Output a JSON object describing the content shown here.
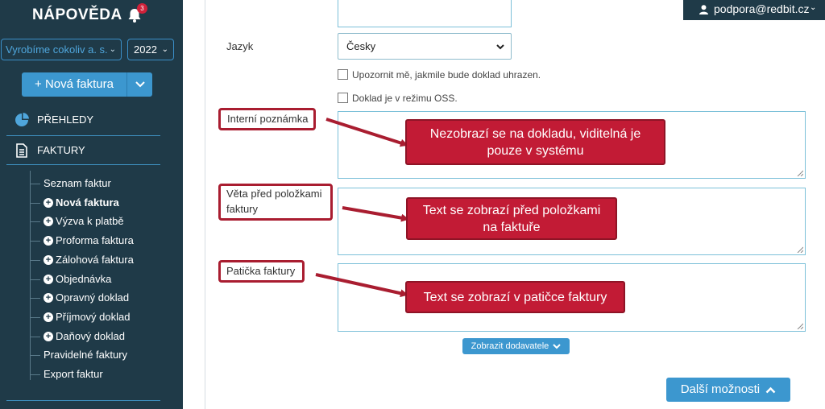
{
  "sidebar": {
    "brand": "NÁPOVĚDA",
    "notification_count": "3",
    "company_select": "Vyrobíme cokoliv a. s.",
    "year_select": "2022",
    "new_invoice_button": "+ Nová faktura",
    "sections": {
      "prehledy": "PŘEHLEDY",
      "faktury": "FAKTURY"
    },
    "items": [
      {
        "label": "Seznam faktur",
        "plus": false,
        "bold": false
      },
      {
        "label": "Nová faktura",
        "plus": true,
        "bold": true
      },
      {
        "label": "Výzva k platbě",
        "plus": true,
        "bold": false
      },
      {
        "label": "Proforma faktura",
        "plus": true,
        "bold": false
      },
      {
        "label": "Zálohová faktura",
        "plus": true,
        "bold": false
      },
      {
        "label": "Objednávka",
        "plus": true,
        "bold": false
      },
      {
        "label": "Opravný doklad",
        "plus": true,
        "bold": false
      },
      {
        "label": "Příjmový doklad",
        "plus": true,
        "bold": false
      },
      {
        "label": "Daňový doklad",
        "plus": true,
        "bold": false
      },
      {
        "label": "Pravidelné faktury",
        "plus": false,
        "bold": false
      },
      {
        "label": "Export faktur",
        "plus": false,
        "bold": false
      }
    ]
  },
  "topbar": {
    "user_email": "podpora@redbit.cz"
  },
  "form": {
    "language_label": "Jazyk",
    "language_value": "Česky",
    "notify_paid_label": "Upozornit mě, jakmile bude doklad uhrazen.",
    "oss_label": "Doklad je v režimu OSS.",
    "internal_note_label": "Interní poznámka",
    "pre_items_label_line1": "Věta před položkami",
    "pre_items_label_line2": "faktury",
    "footer_label": "Patička faktury",
    "show_supplier_button": "Zobrazit dodavatele",
    "more_options_button": "Další možnosti"
  },
  "callouts": {
    "internal_note_line1": "Nezobrazí se na dokladu, viditelná je",
    "internal_note_line2": "pouze v systému",
    "pre_items_line1": "Text se zobrazí před položkami",
    "pre_items_line2": "na faktuře",
    "footer": "Text se zobrazí v patičce faktury"
  },
  "colors": {
    "sidebar_bg": "#1f3a48",
    "accent_blue": "#3c97cf",
    "callout_red": "#c21b35",
    "highlight_border": "#a91d30"
  }
}
